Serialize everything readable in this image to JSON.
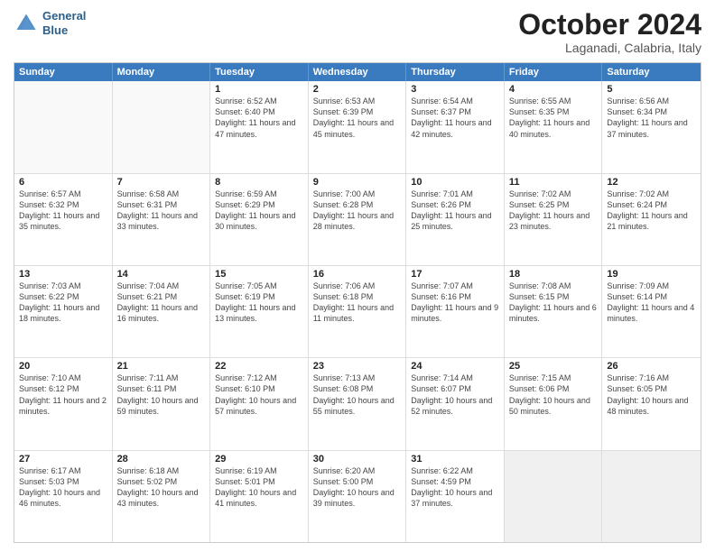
{
  "header": {
    "logo_line1": "General",
    "logo_line2": "Blue",
    "month": "October 2024",
    "location": "Laganadi, Calabria, Italy"
  },
  "weekdays": [
    "Sunday",
    "Monday",
    "Tuesday",
    "Wednesday",
    "Thursday",
    "Friday",
    "Saturday"
  ],
  "rows": [
    [
      {
        "day": "",
        "text": "",
        "empty": true
      },
      {
        "day": "",
        "text": "",
        "empty": true
      },
      {
        "day": "1",
        "text": "Sunrise: 6:52 AM\nSunset: 6:40 PM\nDaylight: 11 hours and 47 minutes."
      },
      {
        "day": "2",
        "text": "Sunrise: 6:53 AM\nSunset: 6:39 PM\nDaylight: 11 hours and 45 minutes."
      },
      {
        "day": "3",
        "text": "Sunrise: 6:54 AM\nSunset: 6:37 PM\nDaylight: 11 hours and 42 minutes."
      },
      {
        "day": "4",
        "text": "Sunrise: 6:55 AM\nSunset: 6:35 PM\nDaylight: 11 hours and 40 minutes."
      },
      {
        "day": "5",
        "text": "Sunrise: 6:56 AM\nSunset: 6:34 PM\nDaylight: 11 hours and 37 minutes."
      }
    ],
    [
      {
        "day": "6",
        "text": "Sunrise: 6:57 AM\nSunset: 6:32 PM\nDaylight: 11 hours and 35 minutes."
      },
      {
        "day": "7",
        "text": "Sunrise: 6:58 AM\nSunset: 6:31 PM\nDaylight: 11 hours and 33 minutes."
      },
      {
        "day": "8",
        "text": "Sunrise: 6:59 AM\nSunset: 6:29 PM\nDaylight: 11 hours and 30 minutes."
      },
      {
        "day": "9",
        "text": "Sunrise: 7:00 AM\nSunset: 6:28 PM\nDaylight: 11 hours and 28 minutes."
      },
      {
        "day": "10",
        "text": "Sunrise: 7:01 AM\nSunset: 6:26 PM\nDaylight: 11 hours and 25 minutes."
      },
      {
        "day": "11",
        "text": "Sunrise: 7:02 AM\nSunset: 6:25 PM\nDaylight: 11 hours and 23 minutes."
      },
      {
        "day": "12",
        "text": "Sunrise: 7:02 AM\nSunset: 6:24 PM\nDaylight: 11 hours and 21 minutes."
      }
    ],
    [
      {
        "day": "13",
        "text": "Sunrise: 7:03 AM\nSunset: 6:22 PM\nDaylight: 11 hours and 18 minutes."
      },
      {
        "day": "14",
        "text": "Sunrise: 7:04 AM\nSunset: 6:21 PM\nDaylight: 11 hours and 16 minutes."
      },
      {
        "day": "15",
        "text": "Sunrise: 7:05 AM\nSunset: 6:19 PM\nDaylight: 11 hours and 13 minutes."
      },
      {
        "day": "16",
        "text": "Sunrise: 7:06 AM\nSunset: 6:18 PM\nDaylight: 11 hours and 11 minutes."
      },
      {
        "day": "17",
        "text": "Sunrise: 7:07 AM\nSunset: 6:16 PM\nDaylight: 11 hours and 9 minutes."
      },
      {
        "day": "18",
        "text": "Sunrise: 7:08 AM\nSunset: 6:15 PM\nDaylight: 11 hours and 6 minutes."
      },
      {
        "day": "19",
        "text": "Sunrise: 7:09 AM\nSunset: 6:14 PM\nDaylight: 11 hours and 4 minutes."
      }
    ],
    [
      {
        "day": "20",
        "text": "Sunrise: 7:10 AM\nSunset: 6:12 PM\nDaylight: 11 hours and 2 minutes."
      },
      {
        "day": "21",
        "text": "Sunrise: 7:11 AM\nSunset: 6:11 PM\nDaylight: 10 hours and 59 minutes."
      },
      {
        "day": "22",
        "text": "Sunrise: 7:12 AM\nSunset: 6:10 PM\nDaylight: 10 hours and 57 minutes."
      },
      {
        "day": "23",
        "text": "Sunrise: 7:13 AM\nSunset: 6:08 PM\nDaylight: 10 hours and 55 minutes."
      },
      {
        "day": "24",
        "text": "Sunrise: 7:14 AM\nSunset: 6:07 PM\nDaylight: 10 hours and 52 minutes."
      },
      {
        "day": "25",
        "text": "Sunrise: 7:15 AM\nSunset: 6:06 PM\nDaylight: 10 hours and 50 minutes."
      },
      {
        "day": "26",
        "text": "Sunrise: 7:16 AM\nSunset: 6:05 PM\nDaylight: 10 hours and 48 minutes."
      }
    ],
    [
      {
        "day": "27",
        "text": "Sunrise: 6:17 AM\nSunset: 5:03 PM\nDaylight: 10 hours and 46 minutes."
      },
      {
        "day": "28",
        "text": "Sunrise: 6:18 AM\nSunset: 5:02 PM\nDaylight: 10 hours and 43 minutes."
      },
      {
        "day": "29",
        "text": "Sunrise: 6:19 AM\nSunset: 5:01 PM\nDaylight: 10 hours and 41 minutes."
      },
      {
        "day": "30",
        "text": "Sunrise: 6:20 AM\nSunset: 5:00 PM\nDaylight: 10 hours and 39 minutes."
      },
      {
        "day": "31",
        "text": "Sunrise: 6:22 AM\nSunset: 4:59 PM\nDaylight: 10 hours and 37 minutes."
      },
      {
        "day": "",
        "text": "",
        "empty": true,
        "shaded": true
      },
      {
        "day": "",
        "text": "",
        "empty": true,
        "shaded": true
      }
    ]
  ]
}
